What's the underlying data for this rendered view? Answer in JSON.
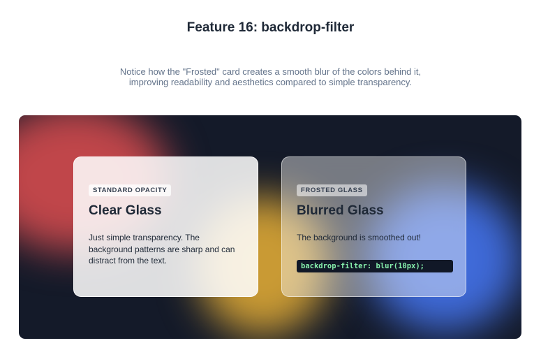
{
  "header": {
    "title": "Feature 16: backdrop-filter",
    "subtitle": "Notice how the \"Frosted\" card creates a smooth blur of the colors behind it, improving readability and aesthetics compared to simple transparency."
  },
  "colors": {
    "red_blob": "#c0464a",
    "yellow_blob": "#c99a34",
    "blue_blob": "#3f6ad8",
    "stage_bg": "#141a29",
    "code_text": "#86efac"
  },
  "cards": {
    "clear": {
      "badge": "STANDARD OPACITY",
      "title": "Clear Glass",
      "text": "Just simple transparency. The background patterns are sharp and can distract from the text."
    },
    "frosted": {
      "badge": "FROSTED GLASS",
      "title": "Blurred Glass",
      "text": "The background is smoothed out!",
      "code": "backdrop-filter: blur(10px);"
    }
  }
}
